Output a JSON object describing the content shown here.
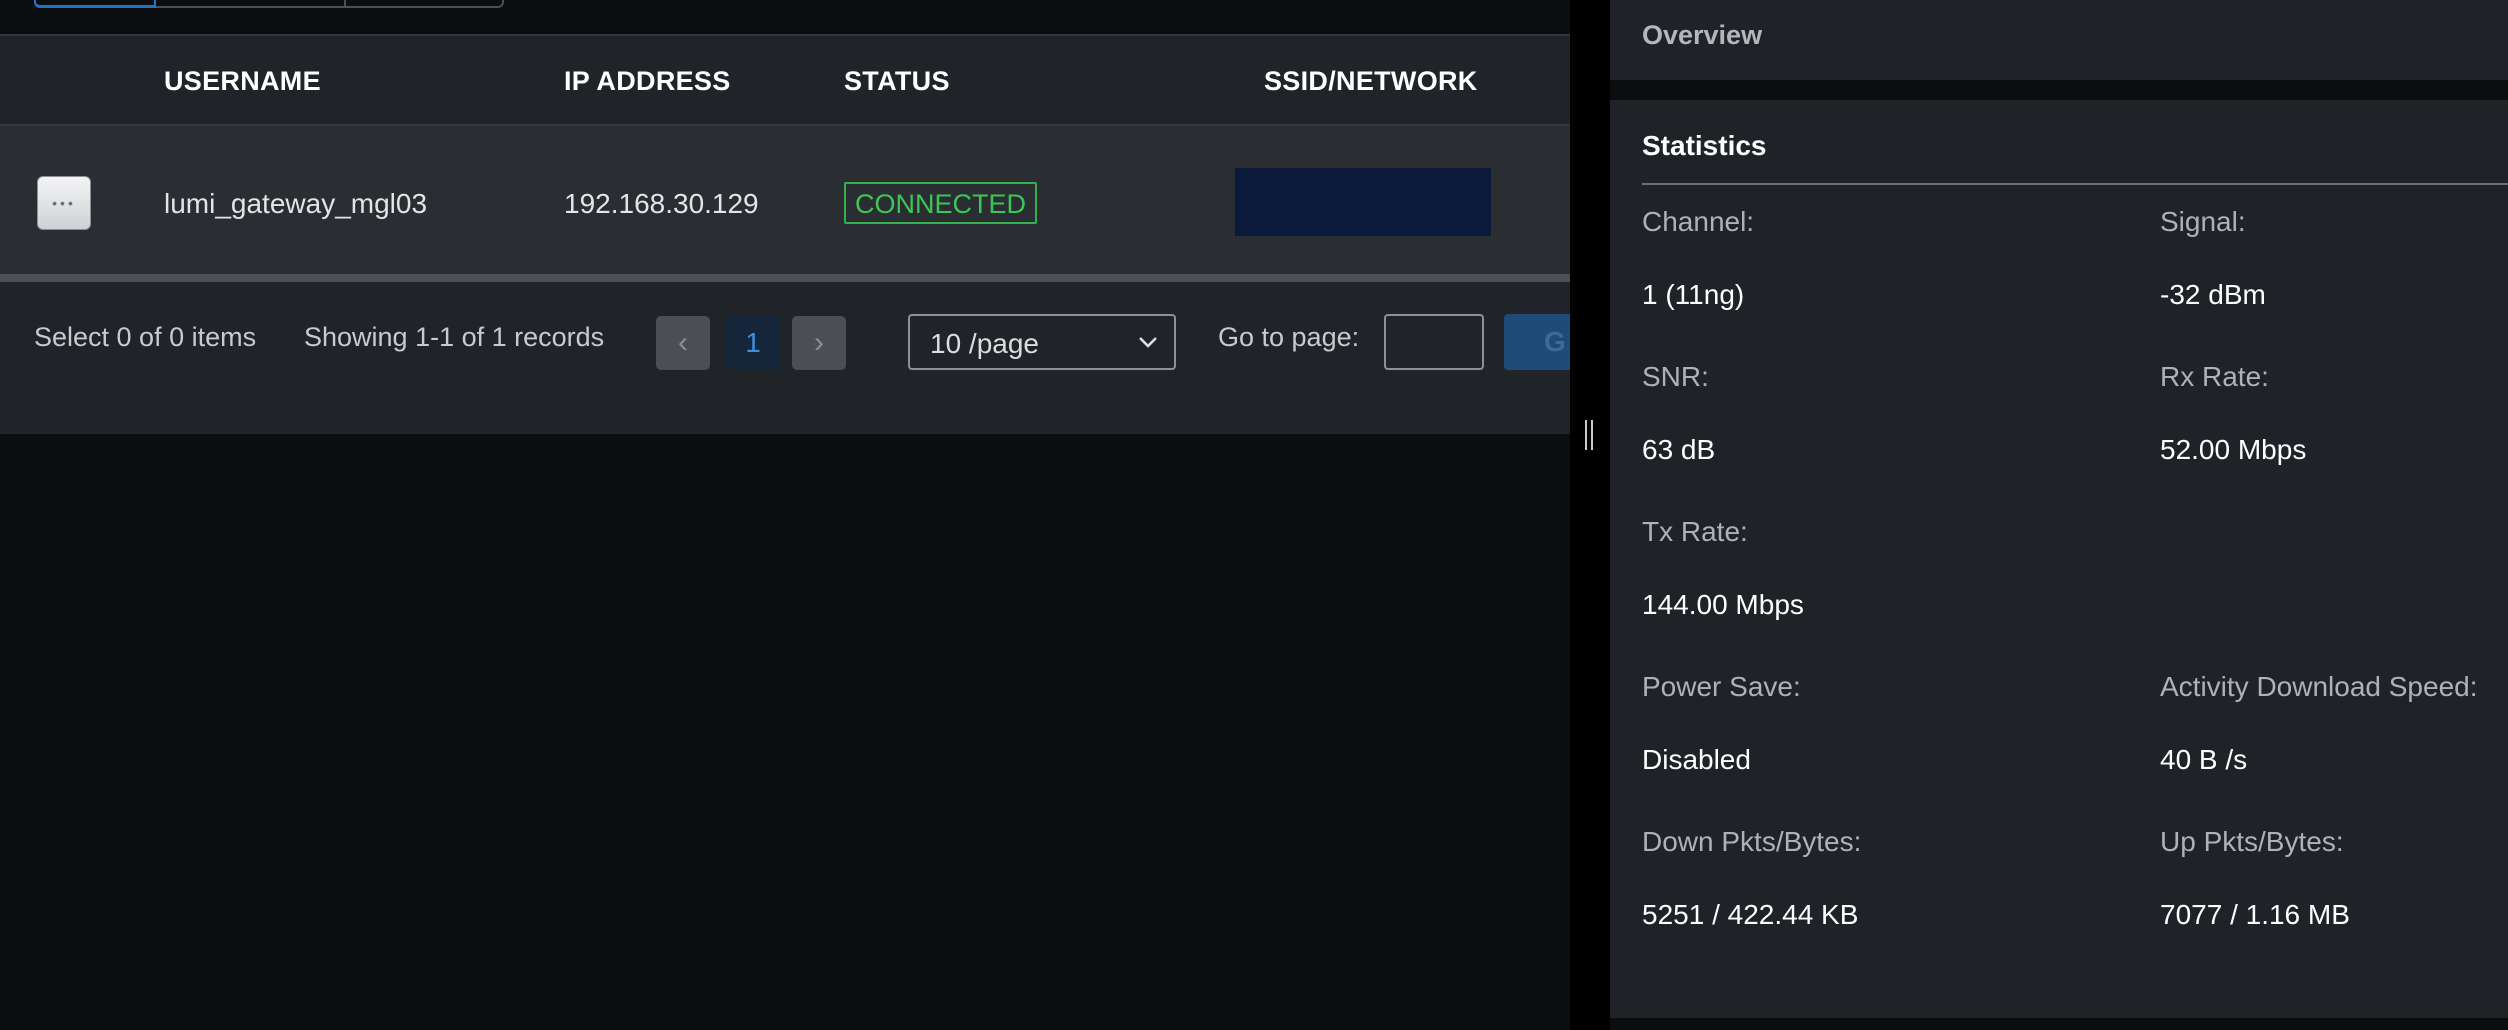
{
  "table": {
    "columns": [
      "USERNAME",
      "IP ADDRESS",
      "STATUS",
      "SSID/NETWORK"
    ],
    "rows": [
      {
        "username": "lumi_gateway_mgl03",
        "ip": "192.168.30.129",
        "status": "CONNECTED",
        "ssid": ""
      }
    ],
    "row_menu_glyph": "•••"
  },
  "footer": {
    "select_text": "Select 0 of 0 items",
    "showing_text": "Showing 1-1 of 1 records",
    "prev_glyph": "‹",
    "next_glyph": "›",
    "current_page": "1",
    "page_size": "10 /page",
    "goto_label": "Go to page:",
    "goto_value": "",
    "go_button": "G"
  },
  "overview": {
    "title": "Overview"
  },
  "statistics": {
    "title": "Statistics",
    "channel_label": "Channel:",
    "channel_value": "1 (11ng)",
    "signal_label": "Signal:",
    "signal_value": "-32 dBm",
    "snr_label": "SNR:",
    "snr_value": "63 dB",
    "rx_label": "Rx Rate:",
    "rx_value": "52.00 Mbps",
    "tx_label": "Tx Rate:",
    "tx_value": "144.00 Mbps",
    "power_label": "Power Save:",
    "power_value": "Disabled",
    "activity_label": "Activity Download Speed:",
    "activity_value": "40 B /s",
    "down_label": "Down Pkts/Bytes:",
    "down_value": "5251 / 422.44 KB",
    "up_label": "Up Pkts/Bytes:",
    "up_value": "7077 / 1.16 MB"
  },
  "colors": {
    "accent_blue": "#1f74c8",
    "status_green": "#3cc656",
    "ssid_fill": "#0b1a3a",
    "panel_bg": "#1f2226"
  },
  "icons": {
    "row_menu": "more-horizontal-icon",
    "prev": "chevron-left-icon",
    "next": "chevron-right-icon",
    "dropdown": "chevron-down-icon",
    "divider": "drag-handle-icon"
  }
}
